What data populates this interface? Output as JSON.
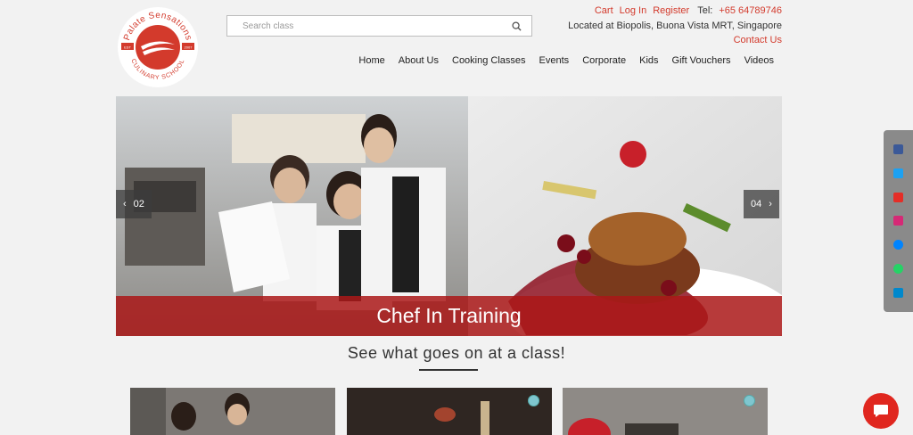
{
  "brand": {
    "logo_top_text": "Palate Sensations",
    "logo_bottom_text": "CULINARY SCHOOL",
    "logo_est": "EST",
    "logo_year": "2007"
  },
  "search": {
    "placeholder": "Search class"
  },
  "top_links": {
    "cart": "Cart",
    "login": "Log In",
    "register": "Register",
    "tel_label": "Tel:",
    "tel_number": "+65 64789746"
  },
  "location": "Located at Biopolis, Buona Vista MRT, Singapore",
  "contact": "Contact Us",
  "nav": [
    "Home",
    "About Us",
    "Cooking Classes",
    "Events",
    "Corporate",
    "Kids",
    "Gift Vouchers",
    "Videos"
  ],
  "hero": {
    "caption": "Chef In Training",
    "prev_label": "02",
    "next_label": "04"
  },
  "section_title": "See what goes on at a class!",
  "social": [
    "facebook-icon",
    "twitter-icon",
    "youtube-icon",
    "instagram-icon",
    "messenger-icon",
    "whatsapp-icon",
    "telegram-icon"
  ],
  "colors": {
    "accent": "#d33a2c",
    "caption_bg": "#aa1818",
    "chat": "#e0271f"
  }
}
